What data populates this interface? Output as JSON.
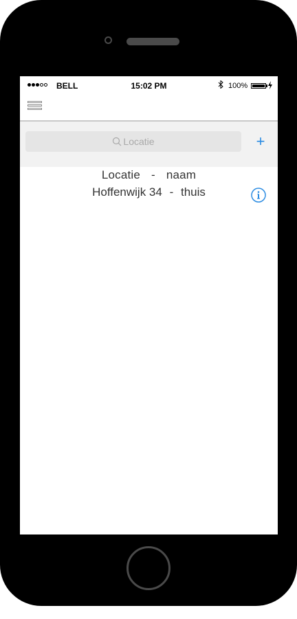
{
  "status_bar": {
    "carrier": "BELL",
    "time": "15:02 PM",
    "battery": "100%",
    "signal_icon": "signal-dots-icon",
    "bluetooth_icon": "bluetooth-icon"
  },
  "navbar": {
    "menu_icon": "hamburger-menu-icon"
  },
  "search": {
    "placeholder": "Locatie",
    "add_label": "+"
  },
  "list": {
    "header": {
      "location": "Locatie",
      "separator": "-",
      "name": "naam"
    },
    "rows": [
      {
        "location": "Hoffenwijk 34",
        "separator": "-",
        "name": "thuis",
        "info_icon": "info-icon"
      }
    ]
  },
  "colors": {
    "accent": "#2a8be2",
    "phone_body": "#000000",
    "search_bg": "#f2f2f2",
    "search_field": "#e5e5e5"
  }
}
